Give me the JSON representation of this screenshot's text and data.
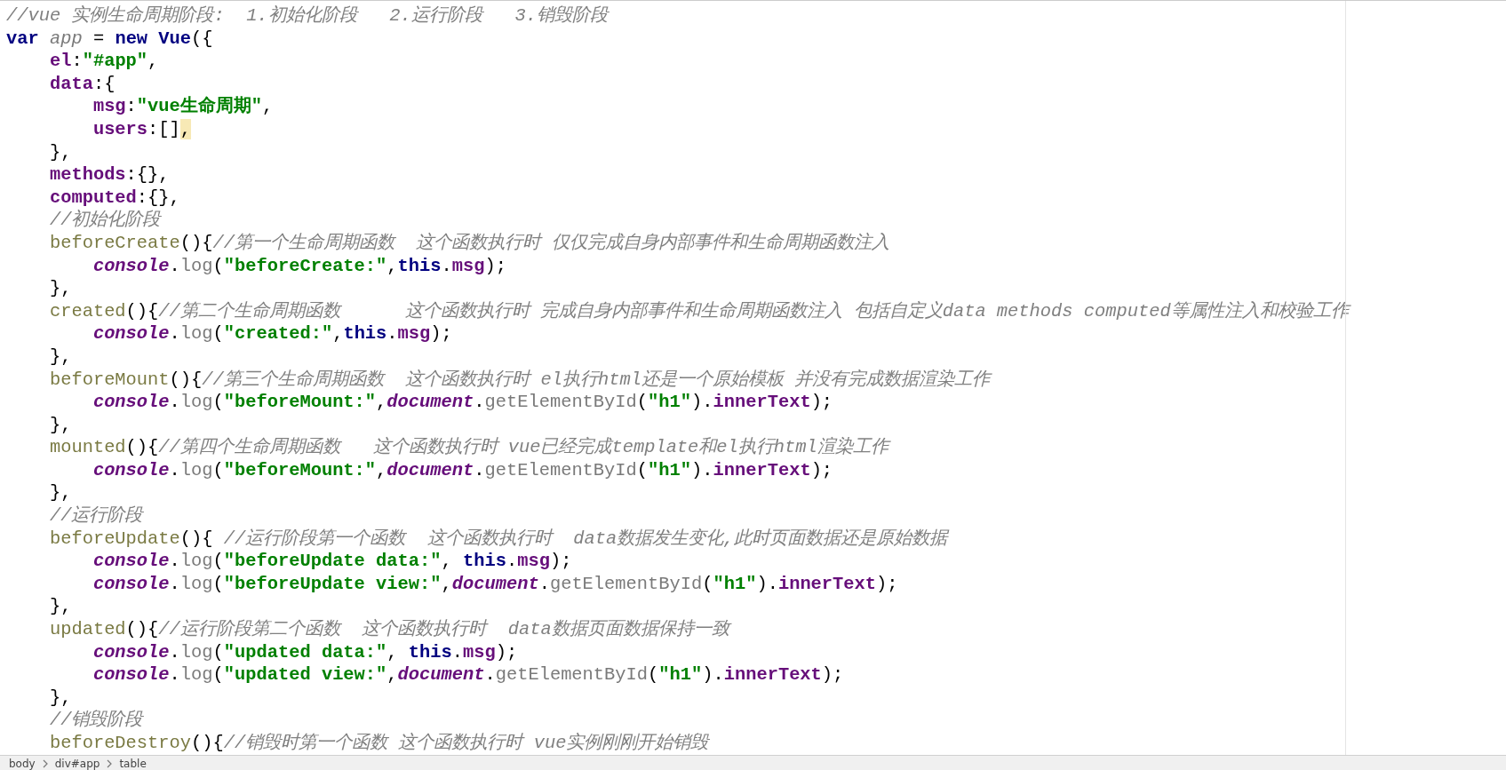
{
  "editor": {
    "lines": [
      [
        {
          "kind": "comment",
          "text": "//vue 实例生命周期阶段:  1.初始化阶段   2.运行阶段   3.销毁阶段"
        }
      ],
      [
        {
          "kind": "keyword",
          "text": "var"
        },
        {
          "kind": "global",
          "text": " app"
        },
        {
          "kind": "plain",
          "text": " = "
        },
        {
          "kind": "keyword",
          "text": "new Vue"
        },
        {
          "kind": "plain",
          "text": "({"
        }
      ],
      [
        {
          "kind": "prop",
          "text": "    el"
        },
        {
          "kind": "plain",
          "text": ":"
        },
        {
          "kind": "string",
          "text": "\"#app\""
        },
        {
          "kind": "plain",
          "text": ","
        }
      ],
      [
        {
          "kind": "prop",
          "text": "    data"
        },
        {
          "kind": "plain",
          "text": ":{"
        }
      ],
      [
        {
          "kind": "prop",
          "text": "        msg"
        },
        {
          "kind": "plain",
          "text": ":"
        },
        {
          "kind": "string",
          "text": "\"vue生命周期\""
        },
        {
          "kind": "plain",
          "text": ","
        }
      ],
      [
        {
          "kind": "prop",
          "text": "        users"
        },
        {
          "kind": "plain",
          "text": ":[]"
        },
        {
          "kind": "match",
          "text": ","
        }
      ],
      [
        {
          "kind": "plain",
          "text": "    },"
        }
      ],
      [
        {
          "kind": "prop",
          "text": "    methods"
        },
        {
          "kind": "plain",
          "text": ":{},"
        }
      ],
      [
        {
          "kind": "prop",
          "text": "    computed"
        },
        {
          "kind": "plain",
          "text": ":{},"
        }
      ],
      [
        {
          "kind": "comment",
          "text": "    //初始化阶段"
        }
      ],
      [
        {
          "kind": "fn",
          "text": "    beforeCreate"
        },
        {
          "kind": "plain",
          "text": "(){"
        },
        {
          "kind": "comment",
          "text": "//第一个生命周期函数  这个函数执行时 仅仅完成自身内部事件和生命周期函数注入"
        }
      ],
      [
        {
          "kind": "object",
          "text": "        console"
        },
        {
          "kind": "plain",
          "text": "."
        },
        {
          "kind": "method",
          "text": "log"
        },
        {
          "kind": "plain",
          "text": "("
        },
        {
          "kind": "string",
          "text": "\"beforeCreate:\""
        },
        {
          "kind": "plain",
          "text": ","
        },
        {
          "kind": "keyword",
          "text": "this"
        },
        {
          "kind": "plain",
          "text": "."
        },
        {
          "kind": "prop",
          "text": "msg"
        },
        {
          "kind": "plain",
          "text": ");"
        }
      ],
      [
        {
          "kind": "plain",
          "text": "    },"
        }
      ],
      [
        {
          "kind": "fn",
          "text": "    created"
        },
        {
          "kind": "plain",
          "text": "(){"
        },
        {
          "kind": "comment",
          "text": "//第二个生命周期函数      这个函数执行时 完成自身内部事件和生命周期函数注入 包括自定义data methods computed等属性注入和校验工作"
        }
      ],
      [
        {
          "kind": "object",
          "text": "        console"
        },
        {
          "kind": "plain",
          "text": "."
        },
        {
          "kind": "method",
          "text": "log"
        },
        {
          "kind": "plain",
          "text": "("
        },
        {
          "kind": "string",
          "text": "\"created:\""
        },
        {
          "kind": "plain",
          "text": ","
        },
        {
          "kind": "keyword",
          "text": "this"
        },
        {
          "kind": "plain",
          "text": "."
        },
        {
          "kind": "prop",
          "text": "msg"
        },
        {
          "kind": "plain",
          "text": ");"
        }
      ],
      [
        {
          "kind": "plain",
          "text": "    },"
        }
      ],
      [
        {
          "kind": "fn",
          "text": "    beforeMount"
        },
        {
          "kind": "plain",
          "text": "(){"
        },
        {
          "kind": "comment",
          "text": "//第三个生命周期函数  这个函数执行时 el执行html还是一个原始模板 并没有完成数据渲染工作"
        }
      ],
      [
        {
          "kind": "object",
          "text": "        console"
        },
        {
          "kind": "plain",
          "text": "."
        },
        {
          "kind": "method",
          "text": "log"
        },
        {
          "kind": "plain",
          "text": "("
        },
        {
          "kind": "string",
          "text": "\"beforeMount:\""
        },
        {
          "kind": "plain",
          "text": ","
        },
        {
          "kind": "object",
          "text": "document"
        },
        {
          "kind": "plain",
          "text": "."
        },
        {
          "kind": "method",
          "text": "getElementById"
        },
        {
          "kind": "plain",
          "text": "("
        },
        {
          "kind": "string",
          "text": "\"h1\""
        },
        {
          "kind": "plain",
          "text": ")."
        },
        {
          "kind": "prop",
          "text": "innerText"
        },
        {
          "kind": "plain",
          "text": ");"
        }
      ],
      [
        {
          "kind": "plain",
          "text": "    },"
        }
      ],
      [
        {
          "kind": "fn",
          "text": "    mounted"
        },
        {
          "kind": "plain",
          "text": "(){"
        },
        {
          "kind": "comment",
          "text": "//第四个生命周期函数   这个函数执行时 vue已经完成template和el执行html渲染工作"
        }
      ],
      [
        {
          "kind": "object",
          "text": "        console"
        },
        {
          "kind": "plain",
          "text": "."
        },
        {
          "kind": "method",
          "text": "log"
        },
        {
          "kind": "plain",
          "text": "("
        },
        {
          "kind": "string",
          "text": "\"beforeMount:\""
        },
        {
          "kind": "plain",
          "text": ","
        },
        {
          "kind": "object",
          "text": "document"
        },
        {
          "kind": "plain",
          "text": "."
        },
        {
          "kind": "method",
          "text": "getElementById"
        },
        {
          "kind": "plain",
          "text": "("
        },
        {
          "kind": "string",
          "text": "\"h1\""
        },
        {
          "kind": "plain",
          "text": ")."
        },
        {
          "kind": "prop",
          "text": "innerText"
        },
        {
          "kind": "plain",
          "text": ");"
        }
      ],
      [
        {
          "kind": "plain",
          "text": "    },"
        }
      ],
      [
        {
          "kind": "comment",
          "text": "    //运行阶段"
        }
      ],
      [
        {
          "kind": "fn",
          "text": "    beforeUpdate"
        },
        {
          "kind": "plain",
          "text": "(){"
        },
        {
          "kind": "comment",
          "text": " //运行阶段第一个函数  这个函数执行时  data数据发生变化,此时页面数据还是原始数据"
        }
      ],
      [
        {
          "kind": "object",
          "text": "        console"
        },
        {
          "kind": "plain",
          "text": "."
        },
        {
          "kind": "method",
          "text": "log"
        },
        {
          "kind": "plain",
          "text": "("
        },
        {
          "kind": "string",
          "text": "\"beforeUpdate data:\""
        },
        {
          "kind": "plain",
          "text": ","
        },
        {
          "kind": "keyword",
          "text": " this"
        },
        {
          "kind": "plain",
          "text": "."
        },
        {
          "kind": "prop",
          "text": "msg"
        },
        {
          "kind": "plain",
          "text": ");"
        }
      ],
      [
        {
          "kind": "object",
          "text": "        console"
        },
        {
          "kind": "plain",
          "text": "."
        },
        {
          "kind": "method",
          "text": "log"
        },
        {
          "kind": "plain",
          "text": "("
        },
        {
          "kind": "string",
          "text": "\"beforeUpdate view:\""
        },
        {
          "kind": "plain",
          "text": ","
        },
        {
          "kind": "object",
          "text": "document"
        },
        {
          "kind": "plain",
          "text": "."
        },
        {
          "kind": "method",
          "text": "getElementById"
        },
        {
          "kind": "plain",
          "text": "("
        },
        {
          "kind": "string",
          "text": "\"h1\""
        },
        {
          "kind": "plain",
          "text": ")."
        },
        {
          "kind": "prop",
          "text": "innerText"
        },
        {
          "kind": "plain",
          "text": ");"
        }
      ],
      [
        {
          "kind": "plain",
          "text": "    },"
        }
      ],
      [
        {
          "kind": "fn",
          "text": "    updated"
        },
        {
          "kind": "plain",
          "text": "(){"
        },
        {
          "kind": "comment",
          "text": "//运行阶段第二个函数  这个函数执行时  data数据页面数据保持一致"
        }
      ],
      [
        {
          "kind": "object",
          "text": "        console"
        },
        {
          "kind": "plain",
          "text": "."
        },
        {
          "kind": "method",
          "text": "log"
        },
        {
          "kind": "plain",
          "text": "("
        },
        {
          "kind": "string",
          "text": "\"updated data:\""
        },
        {
          "kind": "plain",
          "text": ","
        },
        {
          "kind": "keyword",
          "text": " this"
        },
        {
          "kind": "plain",
          "text": "."
        },
        {
          "kind": "prop",
          "text": "msg"
        },
        {
          "kind": "plain",
          "text": ");"
        }
      ],
      [
        {
          "kind": "object",
          "text": "        console"
        },
        {
          "kind": "plain",
          "text": "."
        },
        {
          "kind": "method",
          "text": "log"
        },
        {
          "kind": "plain",
          "text": "("
        },
        {
          "kind": "string",
          "text": "\"updated view:\""
        },
        {
          "kind": "plain",
          "text": ","
        },
        {
          "kind": "object",
          "text": "document"
        },
        {
          "kind": "plain",
          "text": "."
        },
        {
          "kind": "method",
          "text": "getElementById"
        },
        {
          "kind": "plain",
          "text": "("
        },
        {
          "kind": "string",
          "text": "\"h1\""
        },
        {
          "kind": "plain",
          "text": ")."
        },
        {
          "kind": "prop",
          "text": "innerText"
        },
        {
          "kind": "plain",
          "text": ");"
        }
      ],
      [
        {
          "kind": "plain",
          "text": "    },"
        }
      ],
      [
        {
          "kind": "comment",
          "text": "    //销毁阶段"
        }
      ],
      [
        {
          "kind": "fn",
          "text": "    beforeDestroy"
        },
        {
          "kind": "plain",
          "text": "(){"
        },
        {
          "kind": "comment",
          "text": "//销毁时第一个函数 这个函数执行时 vue实例刚刚开始销毁"
        }
      ]
    ]
  },
  "status_bar": {
    "breadcrumbs": [
      "body",
      "div#app",
      "table"
    ]
  }
}
